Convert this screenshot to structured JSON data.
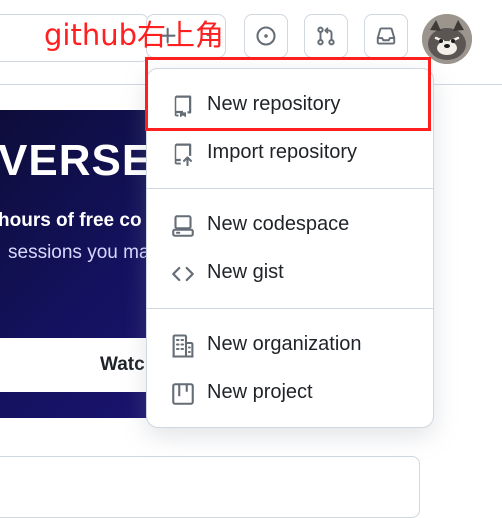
{
  "annotation": {
    "text": "github右上角",
    "color": "#ff1f1f"
  },
  "header": {
    "buttons": [
      {
        "id": "create",
        "icon": "plus-icon"
      },
      {
        "id": "issues",
        "icon": "issue-opened-icon"
      },
      {
        "id": "pull_requests",
        "icon": "git-pull-request-icon"
      },
      {
        "id": "inbox",
        "icon": "inbox-icon"
      }
    ],
    "avatar": "user-avatar"
  },
  "background": {
    "banner_title": "VERSE",
    "banner_line1": "hours of free co",
    "banner_line2": "sessions you ma",
    "banner_button": "Watc"
  },
  "menu": {
    "items": [
      {
        "label": "New repository",
        "icon": "repo-icon",
        "highlighted": true
      },
      {
        "label": "Import repository",
        "icon": "repo-push-icon"
      },
      {
        "label": "New codespace",
        "icon": "codespaces-icon"
      },
      {
        "label": "New gist",
        "icon": "code-icon"
      },
      {
        "label": "New organization",
        "icon": "organization-icon"
      },
      {
        "label": "New project",
        "icon": "table-icon"
      }
    ]
  }
}
